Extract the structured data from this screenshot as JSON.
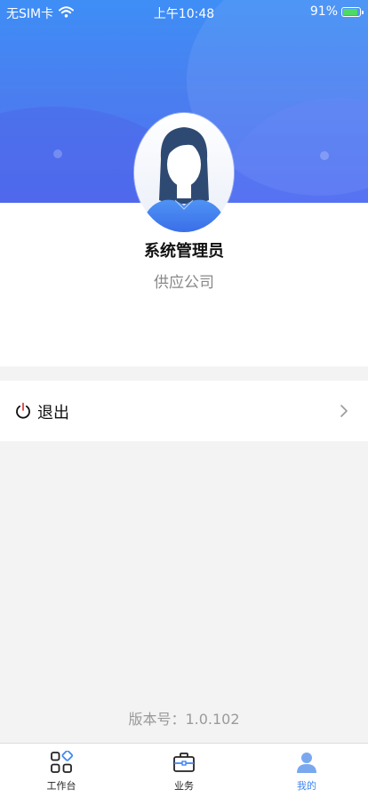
{
  "status_bar": {
    "carrier": "无SIM卡",
    "time": "上午10:48",
    "battery": "91%",
    "battery_level": 0.91
  },
  "profile": {
    "name": "系统管理员",
    "company": "供应公司",
    "avatar_icon": "user-avatar"
  },
  "menu": {
    "logout_label": "退出",
    "logout_icon": "power-icon"
  },
  "footer": {
    "version": "版本号：1.0.102"
  },
  "tabs": [
    {
      "label": "工作台",
      "icon": "workbench-icon",
      "active": false
    },
    {
      "label": "业务",
      "icon": "briefcase-icon",
      "active": false
    },
    {
      "label": "我的",
      "icon": "person-icon",
      "active": true
    }
  ],
  "colors": {
    "primary": "#3f86f3",
    "header_gradient_top": "#3e8ef6",
    "header_gradient_bottom": "#4f6df0",
    "background": "#f3f3f3"
  }
}
